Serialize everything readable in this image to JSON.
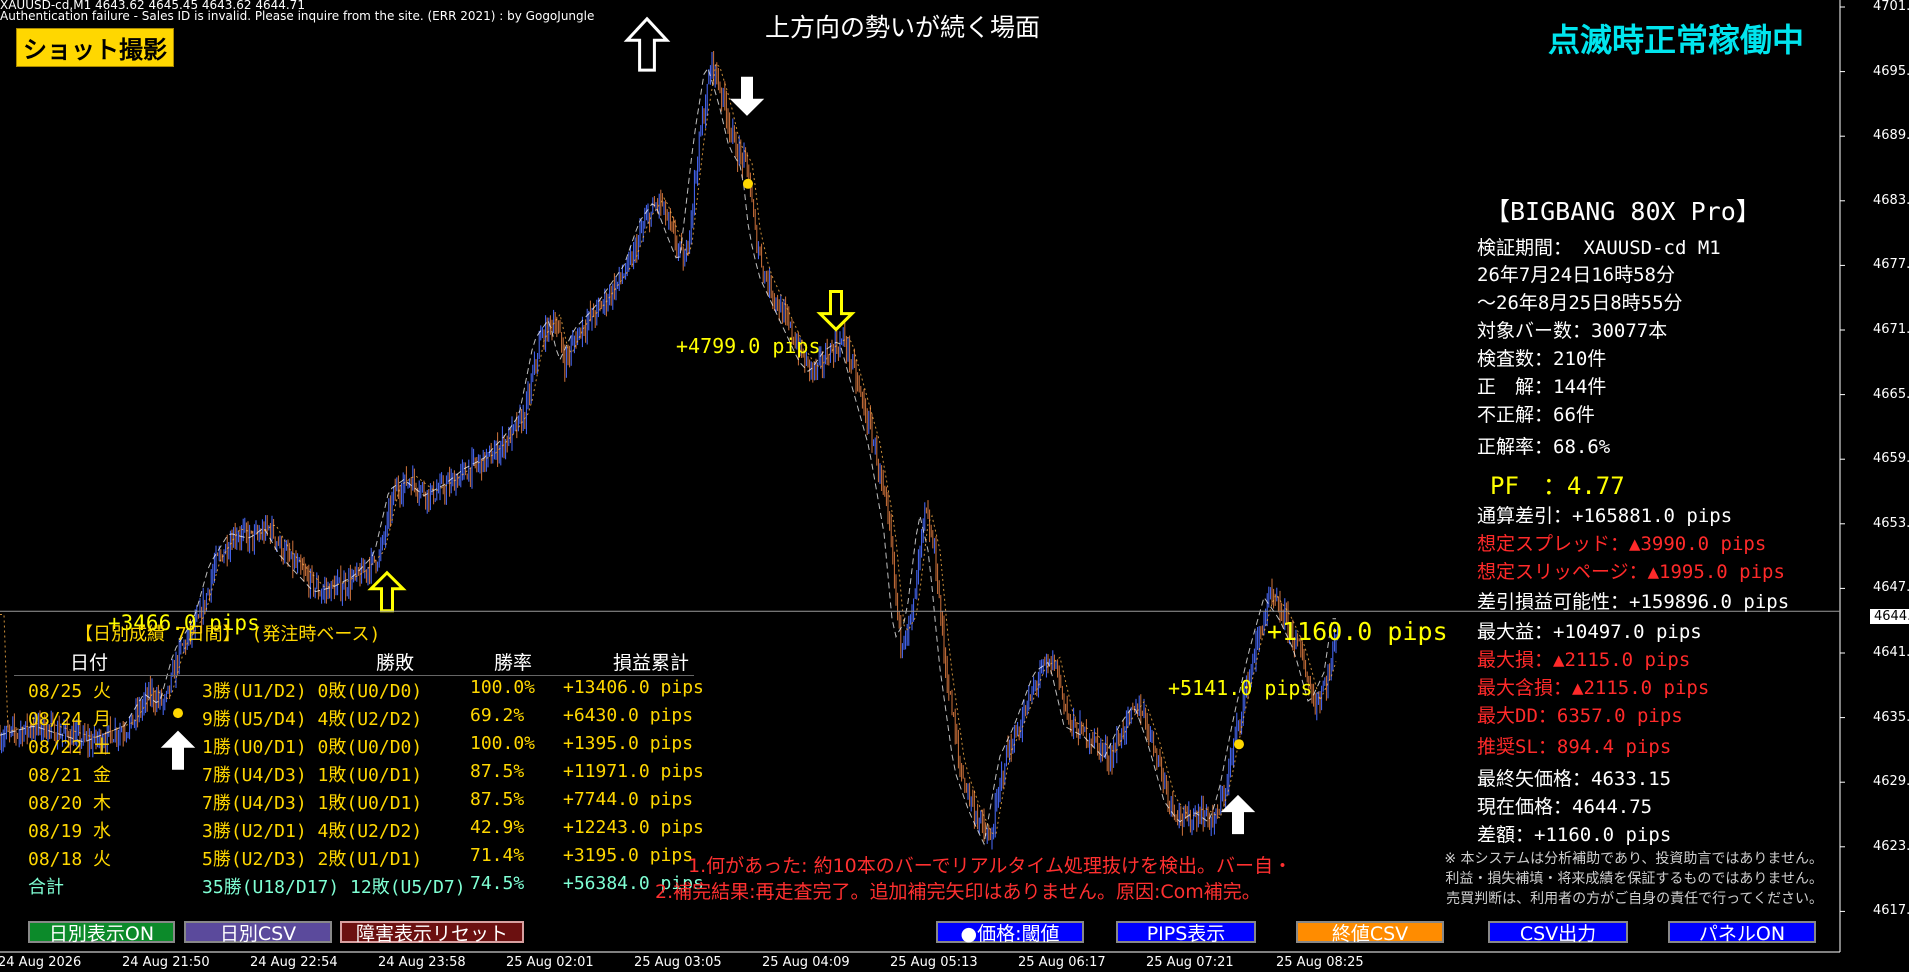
{
  "window": {
    "header_line1": "XAUUSD-cd,M1  4643.62 4645.45 4643.62 4644.71",
    "header_line2": "Authentication failure - Sales ID is invalid. Please inquire from the site. (ERR 2021) : by GogoJungle",
    "screenshot_button": "ショット撮影",
    "headline": "上方向の勢いが続く場面",
    "blink_status": "点滅時正常稼働中"
  },
  "chart_data": {
    "type": "candlestick",
    "symbol": "XAUUSD-cd",
    "timeframe": "M1",
    "current_price": "4644.71",
    "y_ticks": [
      "4701.10",
      "4695.15",
      "4689.15",
      "4683.15",
      "4677.15",
      "4671.15",
      "4665.20",
      "4659.20",
      "4653.20",
      "4647.20",
      "4641.20",
      "4635.25",
      "4629.25",
      "4623.25",
      "4617.25"
    ],
    "x_ticks": [
      "24 Aug 2026",
      "24 Aug 21:50",
      "24 Aug 22:54",
      "24 Aug 23:58",
      "25 Aug 02:01",
      "25 Aug 03:05",
      "25 Aug 04:09",
      "25 Aug 05:13",
      "25 Aug 06:17",
      "25 Aug 07:21",
      "25 Aug 08:25"
    ],
    "ylim": [
      4615.8,
      4701.1
    ],
    "price_path": [
      [
        0,
        4633
      ],
      [
        40,
        4634
      ],
      [
        90,
        4632.5
      ],
      [
        130,
        4634
      ],
      [
        150,
        4637
      ],
      [
        165,
        4636
      ],
      [
        180,
        4641
      ],
      [
        200,
        4644
      ],
      [
        215,
        4649
      ],
      [
        235,
        4652
      ],
      [
        255,
        4651.5
      ],
      [
        270,
        4652.5
      ],
      [
        285,
        4650
      ],
      [
        300,
        4648.5
      ],
      [
        320,
        4646.5
      ],
      [
        340,
        4647
      ],
      [
        360,
        4648
      ],
      [
        380,
        4650
      ],
      [
        395,
        4656
      ],
      [
        410,
        4657
      ],
      [
        430,
        4655.5
      ],
      [
        450,
        4656.5
      ],
      [
        470,
        4658
      ],
      [
        490,
        4659
      ],
      [
        510,
        4661
      ],
      [
        525,
        4663
      ],
      [
        540,
        4670
      ],
      [
        555,
        4672
      ],
      [
        565,
        4668
      ],
      [
        580,
        4671
      ],
      [
        600,
        4673
      ],
      [
        615,
        4675
      ],
      [
        630,
        4677
      ],
      [
        645,
        4681
      ],
      [
        660,
        4683
      ],
      [
        672,
        4680
      ],
      [
        685,
        4677
      ],
      [
        700,
        4689
      ],
      [
        712,
        4696
      ],
      [
        725,
        4692
      ],
      [
        735,
        4688
      ],
      [
        748,
        4686
      ],
      [
        755,
        4680
      ],
      [
        765,
        4676
      ],
      [
        775,
        4674
      ],
      [
        790,
        4671
      ],
      [
        805,
        4668
      ],
      [
        815,
        4667
      ],
      [
        830,
        4669
      ],
      [
        845,
        4670
      ],
      [
        860,
        4665
      ],
      [
        875,
        4660
      ],
      [
        890,
        4652
      ],
      [
        900,
        4642
      ],
      [
        912,
        4644
      ],
      [
        925,
        4654
      ],
      [
        935,
        4650
      ],
      [
        945,
        4640
      ],
      [
        960,
        4630
      ],
      [
        975,
        4626
      ],
      [
        990,
        4623
      ],
      [
        1005,
        4631
      ],
      [
        1020,
        4634
      ],
      [
        1040,
        4639
      ],
      [
        1055,
        4640
      ],
      [
        1070,
        4634
      ],
      [
        1090,
        4633
      ],
      [
        1110,
        4631
      ],
      [
        1125,
        4634
      ],
      [
        1140,
        4636
      ],
      [
        1155,
        4632
      ],
      [
        1170,
        4627
      ],
      [
        1185,
        4625
      ],
      [
        1200,
        4626
      ],
      [
        1215,
        4625
      ],
      [
        1225,
        4628
      ],
      [
        1240,
        4635
      ],
      [
        1255,
        4641
      ],
      [
        1270,
        4646
      ],
      [
        1285,
        4644
      ],
      [
        1300,
        4641
      ],
      [
        1315,
        4636
      ],
      [
        1330,
        4639
      ],
      [
        1338,
        4644
      ]
    ],
    "markers": {
      "arrows": [
        {
          "kind": "up-solid",
          "x": 178,
          "price": 4633.5
        },
        {
          "kind": "up-outline",
          "x": 387,
          "price": 4648.3
        },
        {
          "kind": "up-outline-large",
          "x": 647,
          "price": 4700
        },
        {
          "kind": "down-solid",
          "x": 747,
          "price": 4691
        },
        {
          "kind": "down-outline",
          "x": 836,
          "price": 4671
        },
        {
          "kind": "up-solid",
          "x": 1238,
          "price": 4627.5
        }
      ],
      "dots": [
        {
          "x": 178,
          "price": 4635.2
        },
        {
          "x": 748,
          "price": 4684.6
        },
        {
          "x": 1239,
          "price": 4632.3
        }
      ]
    },
    "trade_labels": [
      {
        "text": "+3466.0 pips",
        "x": 108,
        "price": 4644.7
      },
      {
        "text": "+4799.0 pips",
        "x": 676,
        "price": 4667.2
      },
      {
        "text": "+5141.0 pips",
        "x": 1168,
        "price": 4635.9
      },
      {
        "text": "+1160.0 pips",
        "x": 1267,
        "price": 4644.0
      }
    ]
  },
  "panel": {
    "title": "【BIGBANG 80X Pro】",
    "lines": [
      {
        "text": "検証期間：  XAUUSD-cd M1",
        "color": "w"
      },
      {
        "text": "26年7月24日16時58分",
        "color": "w"
      },
      {
        "text": "～26年8月25日8時55分",
        "color": "w"
      },
      {
        "text": "対象バー数：30077本",
        "color": "w"
      },
      {
        "text": "検査数：210件",
        "color": "w"
      },
      {
        "text": "正　解：144件",
        "color": "w"
      },
      {
        "text": "不正解：66件",
        "color": "w"
      },
      {
        "text": "正解率：68.6%",
        "color": "w"
      },
      {
        "text": "PF　：4.77",
        "color": "y"
      },
      {
        "text": "通算差引：+165881.0 pips",
        "color": "w"
      },
      {
        "text": "想定スプレッド：▲3990.0 pips",
        "color": "r"
      },
      {
        "text": "想定スリッページ：▲1995.0 pips",
        "color": "r"
      },
      {
        "text": "差引損益可能性：+159896.0 pips",
        "color": "w"
      },
      {
        "text": "最大益：+10497.0 pips",
        "color": "w"
      },
      {
        "text": "最大損：▲2115.0 pips",
        "color": "r"
      },
      {
        "text": "最大含損：▲2115.0 pips",
        "color": "r"
      },
      {
        "text": "最大DD：6357.0 pips",
        "color": "r"
      },
      {
        "text": "推奨SL：894.4 pips",
        "color": "r"
      },
      {
        "text": "最終矢価格：4633.15",
        "color": "w"
      },
      {
        "text": "現在価格：4644.75",
        "color": "w"
      },
      {
        "text": "差額：+1160.0 pips",
        "color": "w"
      }
    ],
    "disclaimer": [
      "※ 本システムは分析補助であり、投資助言ではありません。",
      "利益・損失補填・将来成績を保証するものではありません。",
      "売買判断は、利用者の方がご自身の責任で行ってください。"
    ]
  },
  "daily": {
    "title": "【日別成績 7日間】 (発注時ベース)",
    "headers": {
      "date": "日付",
      "result": "勝敗",
      "rate": "勝率",
      "total": "損益累計"
    },
    "rows": [
      {
        "date": "08/25 火",
        "result": "3勝(U1/D2) 0敗(U0/D0)",
        "rate": "100.0%",
        "total": "+13406.0 pips"
      },
      {
        "date": "08/24 月",
        "result": "9勝(U5/D4) 4敗(U2/D2)",
        "rate": "69.2%",
        "total": "+6430.0 pips"
      },
      {
        "date": "08/22 土",
        "result": "1勝(U0/D1) 0敗(U0/D0)",
        "rate": "100.0%",
        "total": "+1395.0 pips"
      },
      {
        "date": "08/21 金",
        "result": "7勝(U4/D3) 1敗(U0/D1)",
        "rate": "87.5%",
        "total": "+11971.0 pips"
      },
      {
        "date": "08/20 木",
        "result": "7勝(U4/D3) 1敗(U0/D1)",
        "rate": "87.5%",
        "total": "+7744.0 pips"
      },
      {
        "date": "08/19 水",
        "result": "3勝(U2/D1) 4敗(U2/D2)",
        "rate": "42.9%",
        "total": "+12243.0 pips"
      },
      {
        "date": "08/18 火",
        "result": "5勝(U2/D3) 2敗(U1/D1)",
        "rate": "71.4%",
        "total": "+3195.0 pips"
      }
    ],
    "total_row": {
      "date": "合計",
      "result": "35勝(U18/D17) 12敗(U5/D7)",
      "rate": "74.5%",
      "total": "+56384.0 pips"
    }
  },
  "incident": {
    "line1": "1.何があった: 約10本のバーでリアルタイム処理抜けを検出。バー自・",
    "line2": "2.補完結果:再走査完了。追加補完矢印はありません。原因:Com補完。"
  },
  "buttons": {
    "daily_on": "日別表示ON",
    "daily_csv": "日別CSV",
    "fault_reset": "障害表示リセット",
    "price_threshold": "●価格:閾値",
    "pips_display": "PIPS表示",
    "close_csv": "終値CSV",
    "csv_output": "CSV出力",
    "panel_on": "パネルON"
  },
  "colors": {
    "bull": "#4a6cff",
    "bear": "#d0743c",
    "background": "#000000",
    "accent_yellow": "#ffff00",
    "accent_cyan": "#00e5ee"
  }
}
